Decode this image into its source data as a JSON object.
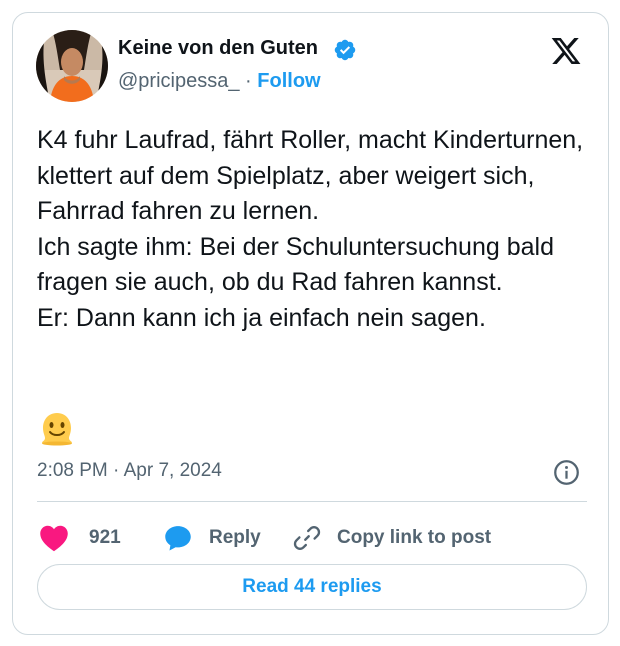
{
  "author": {
    "display_name": "Keine von den Guten",
    "handle": "@pricipessa_",
    "separator": "·",
    "follow_label": "Follow"
  },
  "tweet": {
    "text": "K4 fuhr Laufrad, fährt Roller, macht Kinderturnen, klettert auf dem Spielplatz, aber weigert sich, Fahrrad fahren zu lernen.\nIch sagte ihm: Bei der Schuluntersuchung bald fragen sie auch, ob du Rad fahren kannst.\nEr: Dann kann ich ja einfach nein sagen.",
    "emoji": "melting-face-emoji",
    "timestamp": "2:08 PM · Apr 7, 2024"
  },
  "actions": {
    "like_count": "921",
    "reply_label": "Reply",
    "copy_link_label": "Copy link to post"
  },
  "footer": {
    "read_replies_label": "Read 44 replies"
  },
  "colors": {
    "accent": "#1d9bf0",
    "like": "#f91880",
    "muted": "#536471",
    "text": "#0f1419",
    "border": "#cfd9de"
  },
  "icons": [
    "verified-badge-icon",
    "x-logo-icon",
    "info-icon",
    "heart-icon",
    "reply-bubble-icon",
    "link-icon"
  ]
}
